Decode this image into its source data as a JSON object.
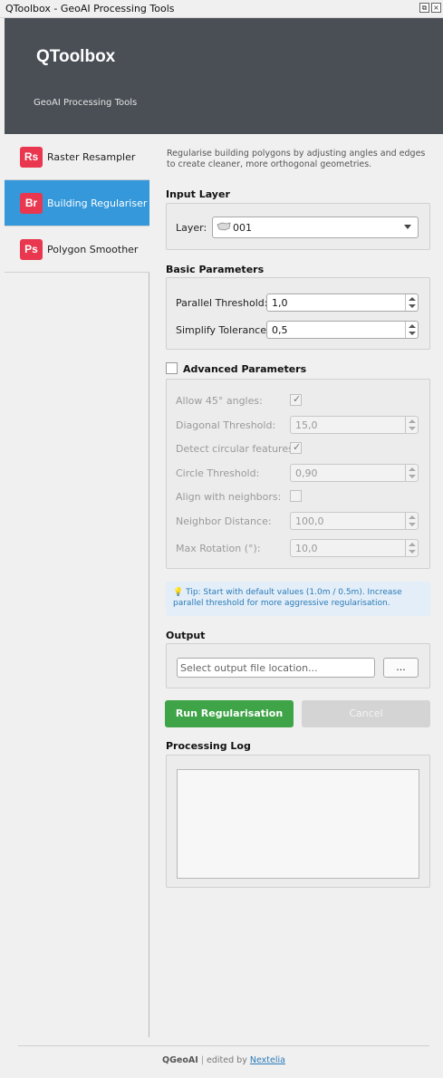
{
  "window": {
    "title": "QToolbox - GeoAI Processing Tools"
  },
  "header": {
    "title": "QToolbox",
    "subtitle": "GeoAI Processing Tools"
  },
  "sidebar": {
    "items": [
      {
        "badge": "Rs",
        "label": "Raster Resampler",
        "active": false
      },
      {
        "badge": "Br",
        "label": "Building Regulariser",
        "active": true
      },
      {
        "badge": "Ps",
        "label": "Polygon Smoother",
        "active": false
      }
    ]
  },
  "main": {
    "description": "Regularise building polygons by adjusting angles and edges to create cleaner, more orthogonal geometries.",
    "input_layer": {
      "title": "Input Layer",
      "layer_label": "Layer:",
      "layer_value": "001"
    },
    "basic": {
      "title": "Basic Parameters",
      "parallel_label": "Parallel Threshold:",
      "parallel_value": "1,0",
      "simplify_label": "Simplify Tolerance:",
      "simplify_value": "0,5"
    },
    "advanced": {
      "title": "Advanced Parameters",
      "enabled": false,
      "allow45_label": "Allow 45° angles:",
      "allow45_checked": true,
      "diagonal_label": "Diagonal Threshold:",
      "diagonal_value": "15,0",
      "circular_label": "Detect circular features:",
      "circular_checked": true,
      "circle_label": "Circle Threshold:",
      "circle_value": "0,90",
      "align_label": "Align with neighbors:",
      "align_checked": false,
      "neighbor_label": "Neighbor Distance:",
      "neighbor_value": "100,0",
      "maxrot_label": "Max Rotation (°):",
      "maxrot_value": "10,0"
    },
    "tip": {
      "text": "Tip: Start with default values (1.0m / 0.5m). Increase parallel threshold for more aggressive regularisation."
    },
    "output": {
      "title": "Output",
      "placeholder": "Select output file location...",
      "browse_label": "..."
    },
    "actions": {
      "run_label": "Run Regularisation",
      "cancel_label": "Cancel"
    },
    "log": {
      "title": "Processing Log"
    }
  },
  "footer": {
    "brand": "QGeoAI",
    "separator": "|",
    "edited_by": "edited by",
    "author": "Nextelia"
  },
  "colors": {
    "header_bg": "#4a4e55",
    "active_item": "#3498db",
    "badge": "#e8374e",
    "run_button": "#3fa447",
    "tip_bg": "#e3eef8",
    "tip_text": "#2a7ab8"
  }
}
